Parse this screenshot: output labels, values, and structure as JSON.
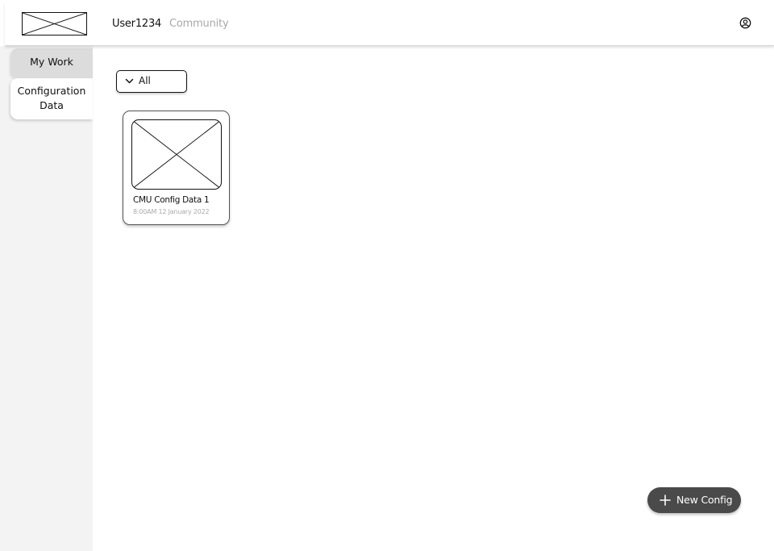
{
  "header": {
    "logo_icon": "image-placeholder-icon",
    "nav": {
      "user": "User1234",
      "community": "Community"
    },
    "account_icon": "user-circle-icon"
  },
  "sidebar": {
    "tabs": [
      {
        "label": "My Work",
        "active": false
      },
      {
        "label": "Configuration Data",
        "line1": "Configuration",
        "line2": "Data",
        "active": true
      }
    ]
  },
  "main": {
    "filter": {
      "selected": "All",
      "icon": "chevron-down-icon"
    },
    "cards": [
      {
        "title": "CMU Config Data 1",
        "timestamp": "8:00AM 12 January 2022",
        "thumbnail_icon": "image-placeholder-icon"
      }
    ],
    "new_button": {
      "label": "New Config",
      "icon": "plus-icon"
    }
  },
  "colors": {
    "sidebar_bg": "#f3f3f3",
    "active_tab_bg": "#ffffff",
    "inactive_tab_bg": "#dcdcdc",
    "muted_text": "#a8a8a8",
    "button_bg": "#4a4a4a",
    "button_text": "#ffffff"
  }
}
